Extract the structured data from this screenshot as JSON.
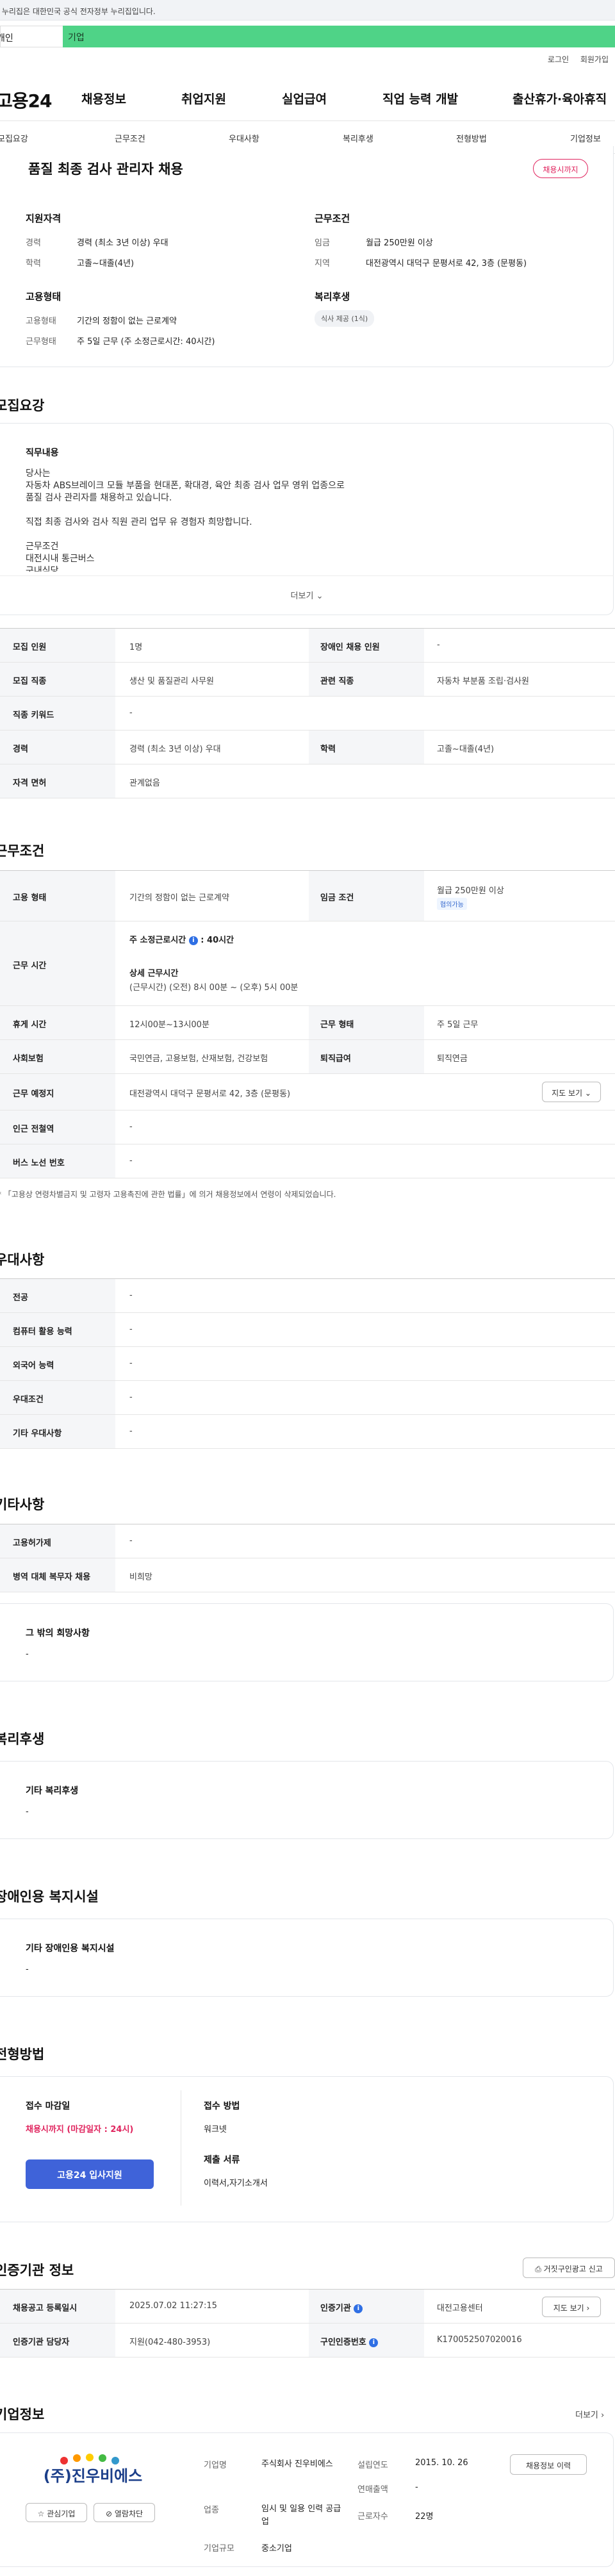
{
  "gov_banner": "이 누리집은 대한민국 공식 전자정부 누리집입니다.",
  "user_tabs": {
    "individual": "개인",
    "company": "기업"
  },
  "util": {
    "login": "로그인",
    "join": "회원가입"
  },
  "gnb": {
    "logo": "고용24",
    "items": [
      "채용정보",
      "취업지원",
      "실업급여",
      "직업 능력 개발",
      "출산휴가·육아휴직"
    ]
  },
  "lnb": [
    "모집요강",
    "근무조건",
    "우대사항",
    "복리후생",
    "전형방법",
    "기업정보"
  ],
  "job": {
    "title": "품질 최종 검사 관리자 채용",
    "deadline": "채용시까지",
    "qual_title": "지원자격",
    "cond_title": "근무조건",
    "career_label": "경력",
    "career": "경력 (최소 3년 이상) 우대",
    "edu_label": "학력",
    "edu": "고졸~대졸(4년)",
    "wage_label": "임금",
    "wage": "월급 250만원 이상",
    "area_label": "지역",
    "area": "대전광역시 대덕구 문평서로 42, 3층 (문평동)",
    "emp_title": "고용형태",
    "welfare_title": "복리후생",
    "emptype_label": "고용형태",
    "emptype": "기간의 정함이 없는 근로계약",
    "worktype_label": "근무형태",
    "worktype": "주 5일 근무 (주 소정근로시간: 40시간)",
    "welfare_chip": "식사 제공 (1식)"
  },
  "recruit": {
    "section": "모집요강",
    "desc_title": "직무내용",
    "desc_lines": [
      "당사는",
      "자동차 ABS브레이크 모듈 부품을 현대폰, 확대경, 육안 최종 검사 업무 영위 업종으로",
      "품질 검사 관리자를 채용하고 있습니다.",
      "",
      "직접 최종 검사와 검사 직원 관리 업무 유 경험자 희망합니다.",
      "",
      "근무조건",
      "대전시내 통근버스",
      "구내식당"
    ],
    "more": "더보기",
    "rows": [
      {
        "l": "모집 인원",
        "lv": "1명",
        "r": "장애인 채용 인원",
        "rv": "-"
      },
      {
        "l": "모집 직종",
        "lv": "생산 및 품질관리 사무원",
        "r": "관련 직종",
        "rv": "자동차 부분품 조립·검사원"
      },
      {
        "l": "직종 키워드",
        "lv": "-"
      },
      {
        "l": "경력",
        "lv": "경력 (최소 3년 이상) 우대",
        "r": "학력",
        "rv": "고졸~대졸(4년)"
      },
      {
        "l": "자격 면허",
        "lv": "관계없음"
      }
    ]
  },
  "work": {
    "section": "근무조건",
    "emp_l": "고용 형태",
    "emp_v": "기간의 정함이 없는 근로계약",
    "wage_l": "임금 조건",
    "wage_v": "월급 250만원 이상",
    "wage_badge": "협의가능",
    "time_l": "근무 시간",
    "time_main": "주 소정근로시간",
    "time_hours": "40시간",
    "time_detail_title": "상세 근무시간",
    "time_detail": "(근무시간) (오전) 8시 00분 ~ (오후) 5시 00분",
    "rest_l": "휴게 시간",
    "rest_v": "12시00분~13시00분",
    "form_l": "근무 형태",
    "form_v": "주 5일 근무",
    "ins_l": "사회보험",
    "ins_v": "국민연금, 고용보험, 산재보험, 건강보험",
    "ret_l": "퇴직급여",
    "ret_v": "퇴직연금",
    "place_l": "근무 예정지",
    "place_v": "대전광역시 대덕구 문평서로 42, 3층 (문평동)",
    "map_btn": "지도 보기",
    "sub_l": "인근 전철역",
    "sub_v": "-",
    "bus_l": "버스 노선 번호",
    "bus_v": "-",
    "note": "* 「고용상 연령차별금지 및 고령자 고용촉진에 관한 법률」에 의거 채용정보에서 연령이 삭제되었습니다."
  },
  "pref": {
    "section": "우대사항",
    "rows": [
      {
        "l": "전공",
        "v": "-"
      },
      {
        "l": "컴퓨터 활용 능력",
        "v": "-"
      },
      {
        "l": "외국어 능력",
        "v": "-"
      },
      {
        "l": "우대조건",
        "v": "-"
      },
      {
        "l": "기타 우대사항",
        "v": "-"
      }
    ]
  },
  "etc": {
    "section": "기타사항",
    "rows": [
      {
        "l": "고용허가제",
        "v": "-"
      },
      {
        "l": "병역 대체 복무자 채용",
        "v": "비희망"
      }
    ],
    "other_title": "그 밖의 희망사항",
    "other_v": "-"
  },
  "welfare": {
    "section": "복리후생",
    "title": "기타 복리후생",
    "v": "-"
  },
  "disab": {
    "section": "장애인용 복지시설",
    "title": "기타 장애인용 복지시설",
    "v": "-"
  },
  "process": {
    "section": "전형방법",
    "deadline_title": "접수 마감일",
    "deadline_v": "채용시까지 (마감일자 : 24시)",
    "apply_btn": "고용24 입사지원",
    "method_title": "접수 방법",
    "method_v": "워크넷",
    "docs_title": "제출 서류",
    "docs_v": "이력서,자기소개서"
  },
  "cert": {
    "section": "인증기관 정보",
    "report_btn": "거짓구인광고 신고",
    "reg_l": "채용공고 등록일시",
    "reg_v": "2025.07.02 11:27:15",
    "org_l": "인증기관",
    "org_v": "대전고용센터",
    "map_btn": "지도 보기",
    "mgr_l": "인증기관 담당자",
    "mgr_v": "지원(042-480-3953)",
    "num_l": "구인인증번호",
    "num_v": "K170052507020016"
  },
  "company": {
    "section": "기업정보",
    "more": "더보기",
    "logo_text": "(주)진우비에스",
    "fav_btn": "관심기업",
    "block_btn": "열람차단",
    "name_l": "기업명",
    "name_v": "주식회사 진우비에스",
    "est_l": "설립연도",
    "est_v": "2015. 10. 26",
    "sales_l": "연매출액",
    "sales_v": "-",
    "ind_l": "업종",
    "ind_v": "임시 및 일용 인력 공급업",
    "emp_l": "근로자수",
    "emp_v": "22명",
    "size_l": "기업규모",
    "size_v": "중소기업",
    "jobs_btn": "채용정보 이력"
  },
  "colors": {
    "accent": "#3f63d9",
    "green": "#4fd387",
    "red": "#e0245e"
  }
}
